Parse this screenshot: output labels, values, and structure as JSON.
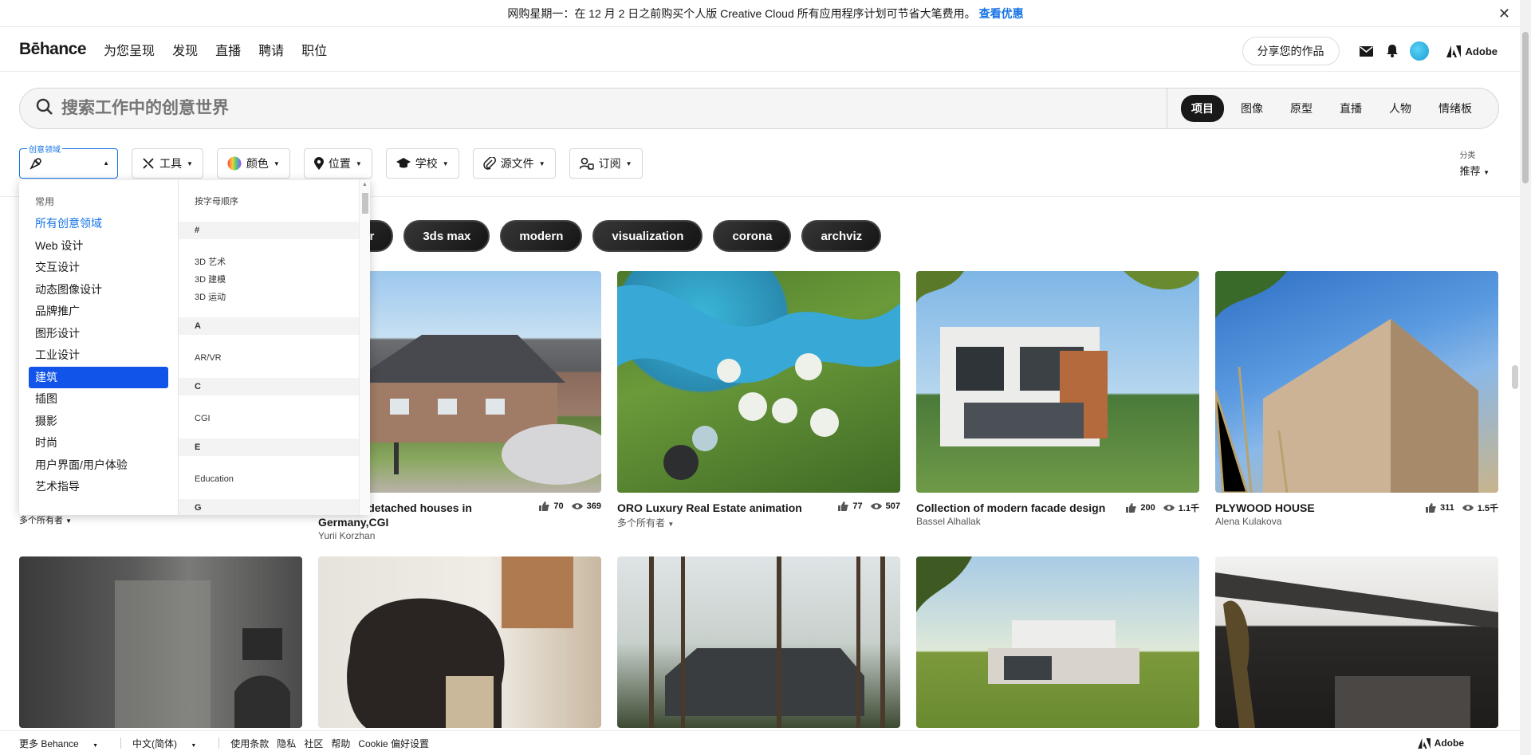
{
  "promo": {
    "text": "网购星期一：在 12 月 2 日之前购买个人版 Creative Cloud 所有应用程序计划可节省大笔费用。",
    "link": "查看优惠"
  },
  "nav": {
    "logo": "Bēhance",
    "links": [
      "为您呈现",
      "发现",
      "直播",
      "聘请",
      "职位"
    ],
    "share": "分享您的作品",
    "adobe": "Adobe"
  },
  "search": {
    "placeholder": "搜索工作中的创意世界",
    "tabs": [
      "项目",
      "图像",
      "原型",
      "直播",
      "人物",
      "情绪板"
    ],
    "active_tab": "项目"
  },
  "filters": {
    "category_label": "创意领域",
    "buttons": [
      "工具",
      "颜色",
      "位置",
      "学校",
      "源文件",
      "订阅"
    ],
    "sort_label": "分类",
    "sort_value": "推荐"
  },
  "tags": [
    "der",
    "3ds max",
    "modern",
    "visualization",
    "corona",
    "archviz"
  ],
  "dropdown": {
    "common_header": "常用",
    "common_items": [
      "所有创意领域",
      "Web 设计",
      "交互设计",
      "动态图像设计",
      "品牌推广",
      "图形设计",
      "工业设计",
      "建筑",
      "插图",
      "摄影",
      "时尚",
      "用户界面/用户体验",
      "艺术指导"
    ],
    "alpha_header": "按字母顺序",
    "groups": [
      {
        "letter": "#",
        "items": [
          "3D 艺术",
          "3D 建模",
          "3D 运动"
        ]
      },
      {
        "letter": "A",
        "items": [
          "AR/VR"
        ]
      },
      {
        "letter": "C",
        "items": [
          "CGI"
        ]
      },
      {
        "letter": "E",
        "items": [
          "Education"
        ]
      },
      {
        "letter": "G",
        "items": []
      }
    ]
  },
  "projects": [
    {
      "title": "…ization detached houses in Germany,CGI",
      "owner": "Yurii Korzhan",
      "likes": "70",
      "views": "369"
    },
    {
      "title": "ORO Luxury Real Estate animation",
      "owner": "多个所有者",
      "likes": "77",
      "views": "507"
    },
    {
      "title": "Collection of modern facade design",
      "owner": "Bassel Alhallak",
      "likes": "200",
      "views": "1.1千"
    },
    {
      "title": "PLYWOOD HOUSE",
      "owner": "Alena Kulakova",
      "likes": "311",
      "views": "1.5千"
    }
  ],
  "first_card_owner": "多个所有者",
  "footer": {
    "more": "更多 Behance",
    "lang": "中文(简体)",
    "links": [
      "使用条款",
      "隐私",
      "社区",
      "帮助",
      "Cookie 偏好设置"
    ],
    "adobe": "Adobe"
  }
}
